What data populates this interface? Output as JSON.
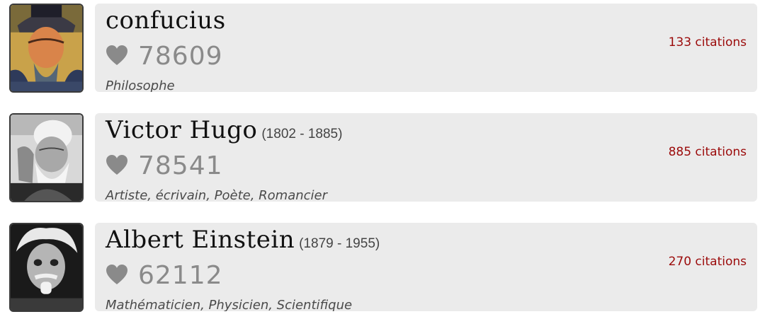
{
  "authors": [
    {
      "name": "confucius",
      "dates": "",
      "likes": "78609",
      "occupation": "Philosophe",
      "citations": "133 citations"
    },
    {
      "name": "Victor Hugo",
      "dates": "(1802 - 1885)",
      "likes": "78541",
      "occupation": "Artiste, écrivain, Poète, Romancier",
      "citations": "885 citations"
    },
    {
      "name": "Albert Einstein",
      "dates": "(1879 - 1955)",
      "likes": "62112",
      "occupation": "Mathématicien, Physicien, Scientifique",
      "citations": "270 citations"
    }
  ],
  "icons": {
    "like": "heart-icon"
  },
  "colors": {
    "card_background": "#ebebeb",
    "citations_link": "#9b0a0a",
    "like_count": "#8a8a8a"
  }
}
